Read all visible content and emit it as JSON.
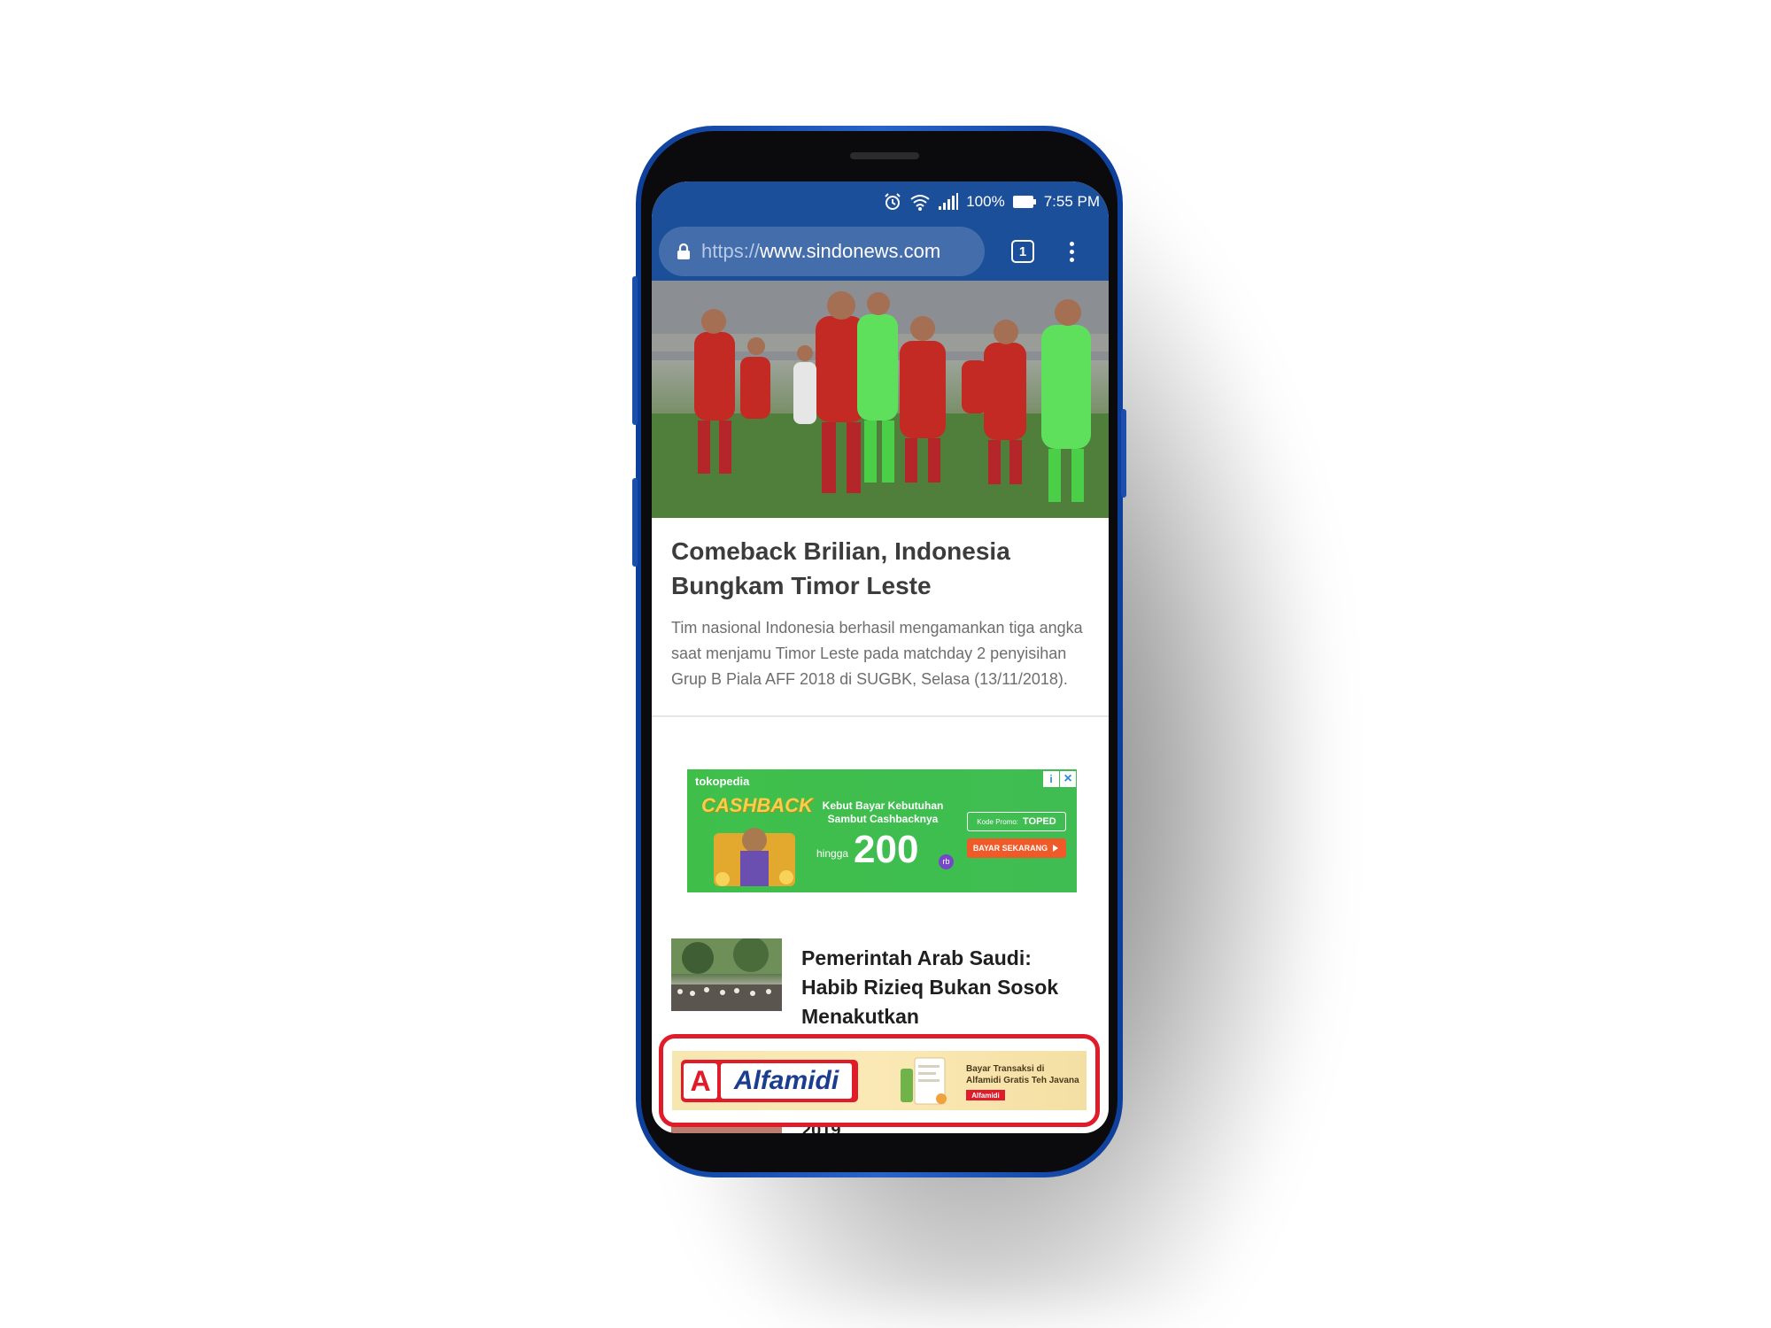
{
  "status_bar": {
    "battery": "100%",
    "time": "7:55 PM",
    "icons": [
      "alarm-icon",
      "wifi-icon",
      "signal-icon",
      "battery-icon"
    ]
  },
  "browser": {
    "url_scheme": "https://",
    "url_host": "www.sindonews.com",
    "tab_count": "1",
    "accent_color": "#1c4f99"
  },
  "lead_article": {
    "headline": "Comeback Brilian, Indonesia Bungkam Timor Leste",
    "summary": "Tim nasional Indonesia berhasil mengamankan tiga angka saat menjamu Timor Leste pada matchday 2 penyisihan Grup B Piala AFF 2018 di SUGBK, Selasa (13/11/2018)."
  },
  "ad_tokopedia": {
    "brand": "tokopedia",
    "badge": "CASHBACK",
    "headline": "Kebut Bayar Kebutuhan Sambut Cashbacknya",
    "upto": "hingga",
    "amount": "200",
    "unit": "rb",
    "promo_label": "Kode Promo:",
    "promo_code": "TOPED",
    "cta": "BAYAR SEKARANG"
  },
  "news_list": {
    "item_title": "Pemerintah Arab Saudi: Habib Rizieq Bukan Sosok Menakutkan",
    "peek_title": "2019"
  },
  "sticky_ad": {
    "logo_initial": "A",
    "logo_word": "Alfamidi",
    "text": "Bayar Transaksi di Alfamidi Gratis Teh Javana",
    "mini_logo": "Alfamidi",
    "highlight_color": "#e01b2a"
  }
}
